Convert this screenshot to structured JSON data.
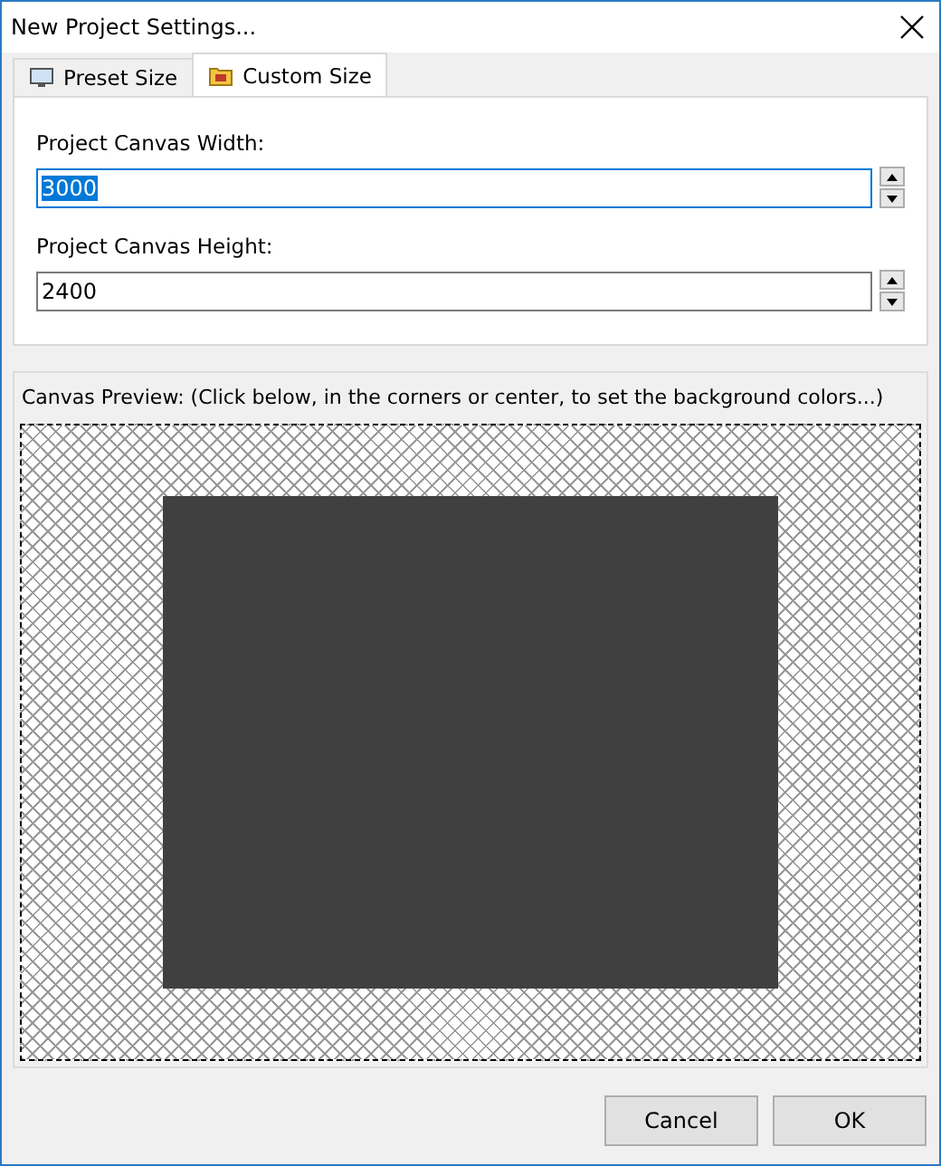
{
  "window": {
    "title": "New Project Settings..."
  },
  "tabs": [
    {
      "label": "Preset Size",
      "selected": false
    },
    {
      "label": "Custom Size",
      "selected": true
    }
  ],
  "fields": [
    {
      "label": "Project Canvas Width:",
      "value": "3000",
      "highlighted": true
    },
    {
      "label": "Project Canvas Height:",
      "value": "2400",
      "highlighted": false
    }
  ],
  "preview": {
    "label": "Canvas Preview: (Click below, in the corners or center, to set the background colors...)"
  },
  "buttons": [
    "Cancel",
    "OK"
  ]
}
